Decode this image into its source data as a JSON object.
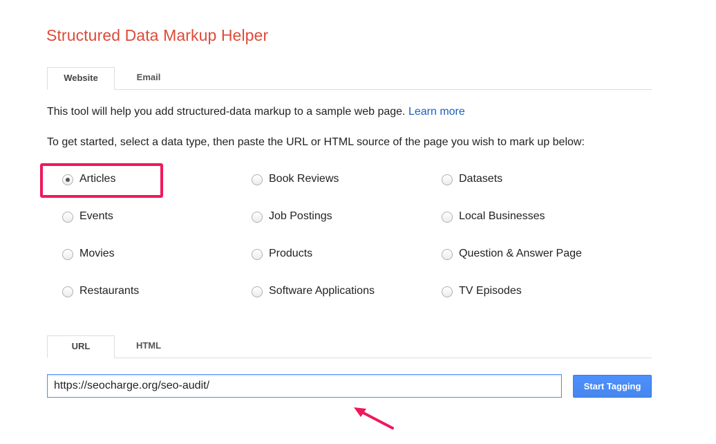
{
  "app": {
    "title": "Structured Data Markup Helper"
  },
  "source_tabs": [
    {
      "label": "Website",
      "active": true
    },
    {
      "label": "Email",
      "active": false
    }
  ],
  "intro": {
    "text": "This tool will help you add structured-data markup to a sample web page.",
    "link_label": "Learn more"
  },
  "instructions": "To get started, select a data type, then paste the URL or HTML source of the page you wish to mark up below:",
  "data_types": [
    {
      "label": "Articles",
      "checked": true
    },
    {
      "label": "Book Reviews",
      "checked": false
    },
    {
      "label": "Datasets",
      "checked": false
    },
    {
      "label": "Events",
      "checked": false
    },
    {
      "label": "Job Postings",
      "checked": false
    },
    {
      "label": "Local Businesses",
      "checked": false
    },
    {
      "label": "Movies",
      "checked": false
    },
    {
      "label": "Products",
      "checked": false
    },
    {
      "label": "Question & Answer Page",
      "checked": false
    },
    {
      "label": "Restaurants",
      "checked": false
    },
    {
      "label": "Software Applications",
      "checked": false
    },
    {
      "label": "TV Episodes",
      "checked": false
    }
  ],
  "input_tabs": [
    {
      "label": "URL",
      "active": true
    },
    {
      "label": "HTML",
      "active": false
    }
  ],
  "url_field": {
    "value": "https://seocharge.org/seo-audit/"
  },
  "start_button_label": "Start Tagging",
  "colors": {
    "title": "#dd4b39",
    "link": "#1a5fbd",
    "highlight": "#f0185b",
    "button": "#4d90fe"
  },
  "annotations": {
    "highlight_box_icon": "highlight-rectangle",
    "arrow_icon": "pointer-arrow"
  }
}
